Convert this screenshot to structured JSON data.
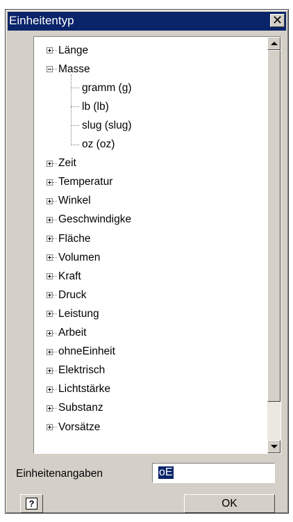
{
  "window": {
    "title": "Einheitentyp"
  },
  "tree": {
    "items": [
      {
        "label": "Länge",
        "expanded": false
      },
      {
        "label": "Masse",
        "expanded": true,
        "children": [
          "gramm (g)",
          "lb (lb)",
          "slug (slug)",
          "oz (oz)"
        ]
      },
      {
        "label": "Zeit",
        "expanded": false
      },
      {
        "label": "Temperatur",
        "expanded": false
      },
      {
        "label": "Winkel",
        "expanded": false
      },
      {
        "label": "Geschwindigke",
        "expanded": false
      },
      {
        "label": "Fläche",
        "expanded": false
      },
      {
        "label": "Volumen",
        "expanded": false
      },
      {
        "label": "Kraft",
        "expanded": false
      },
      {
        "label": "Druck",
        "expanded": false
      },
      {
        "label": "Leistung",
        "expanded": false
      },
      {
        "label": "Arbeit",
        "expanded": false
      },
      {
        "label": "ohneEinheit",
        "expanded": false
      },
      {
        "label": "Elektrisch",
        "expanded": false
      },
      {
        "label": "Lichtstärke",
        "expanded": false
      },
      {
        "label": "Substanz",
        "expanded": false
      },
      {
        "label": "Vorsätze",
        "expanded": false
      }
    ]
  },
  "units": {
    "label": "Einheitenangaben",
    "value": "oE"
  },
  "buttons": {
    "help_icon": "?",
    "ok_label": "OK",
    "close_icon": "✕"
  },
  "colors": {
    "titlebar": "#0a246a",
    "face": "#d4d0c8",
    "selection": "#0a246a"
  }
}
